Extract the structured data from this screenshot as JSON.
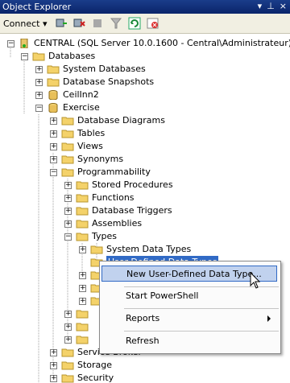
{
  "window": {
    "title": "Object Explorer",
    "pin": "▾",
    "pin2": "⊥",
    "close": "×"
  },
  "toolbar": {
    "connect_label": "Connect",
    "connect_caret": "▾"
  },
  "tree": {
    "root": "CENTRAL (SQL Server 10.0.1600 - Central\\Administrateur)",
    "databases": "Databases",
    "system_databases": "System Databases",
    "database_snapshots": "Database Snapshots",
    "ceilinn2": "CeilInn2",
    "exercise": "Exercise",
    "database_diagrams": "Database Diagrams",
    "tables": "Tables",
    "views": "Views",
    "synonyms": "Synonyms",
    "programmability": "Programmability",
    "stored_procedures": "Stored Procedures",
    "functions": "Functions",
    "database_triggers": "Database Triggers",
    "assemblies": "Assemblies",
    "types": "Types",
    "system_data_types": "System Data Types",
    "user_defined_data_types": "User-Defined Data Types",
    "service_broker": "Service Broker",
    "storage": "Storage",
    "security": "Security"
  },
  "context_menu": {
    "new_type": "New User-Defined Data Type...",
    "start_powershell": "Start PowerShell",
    "reports": "Reports",
    "refresh": "Refresh"
  }
}
